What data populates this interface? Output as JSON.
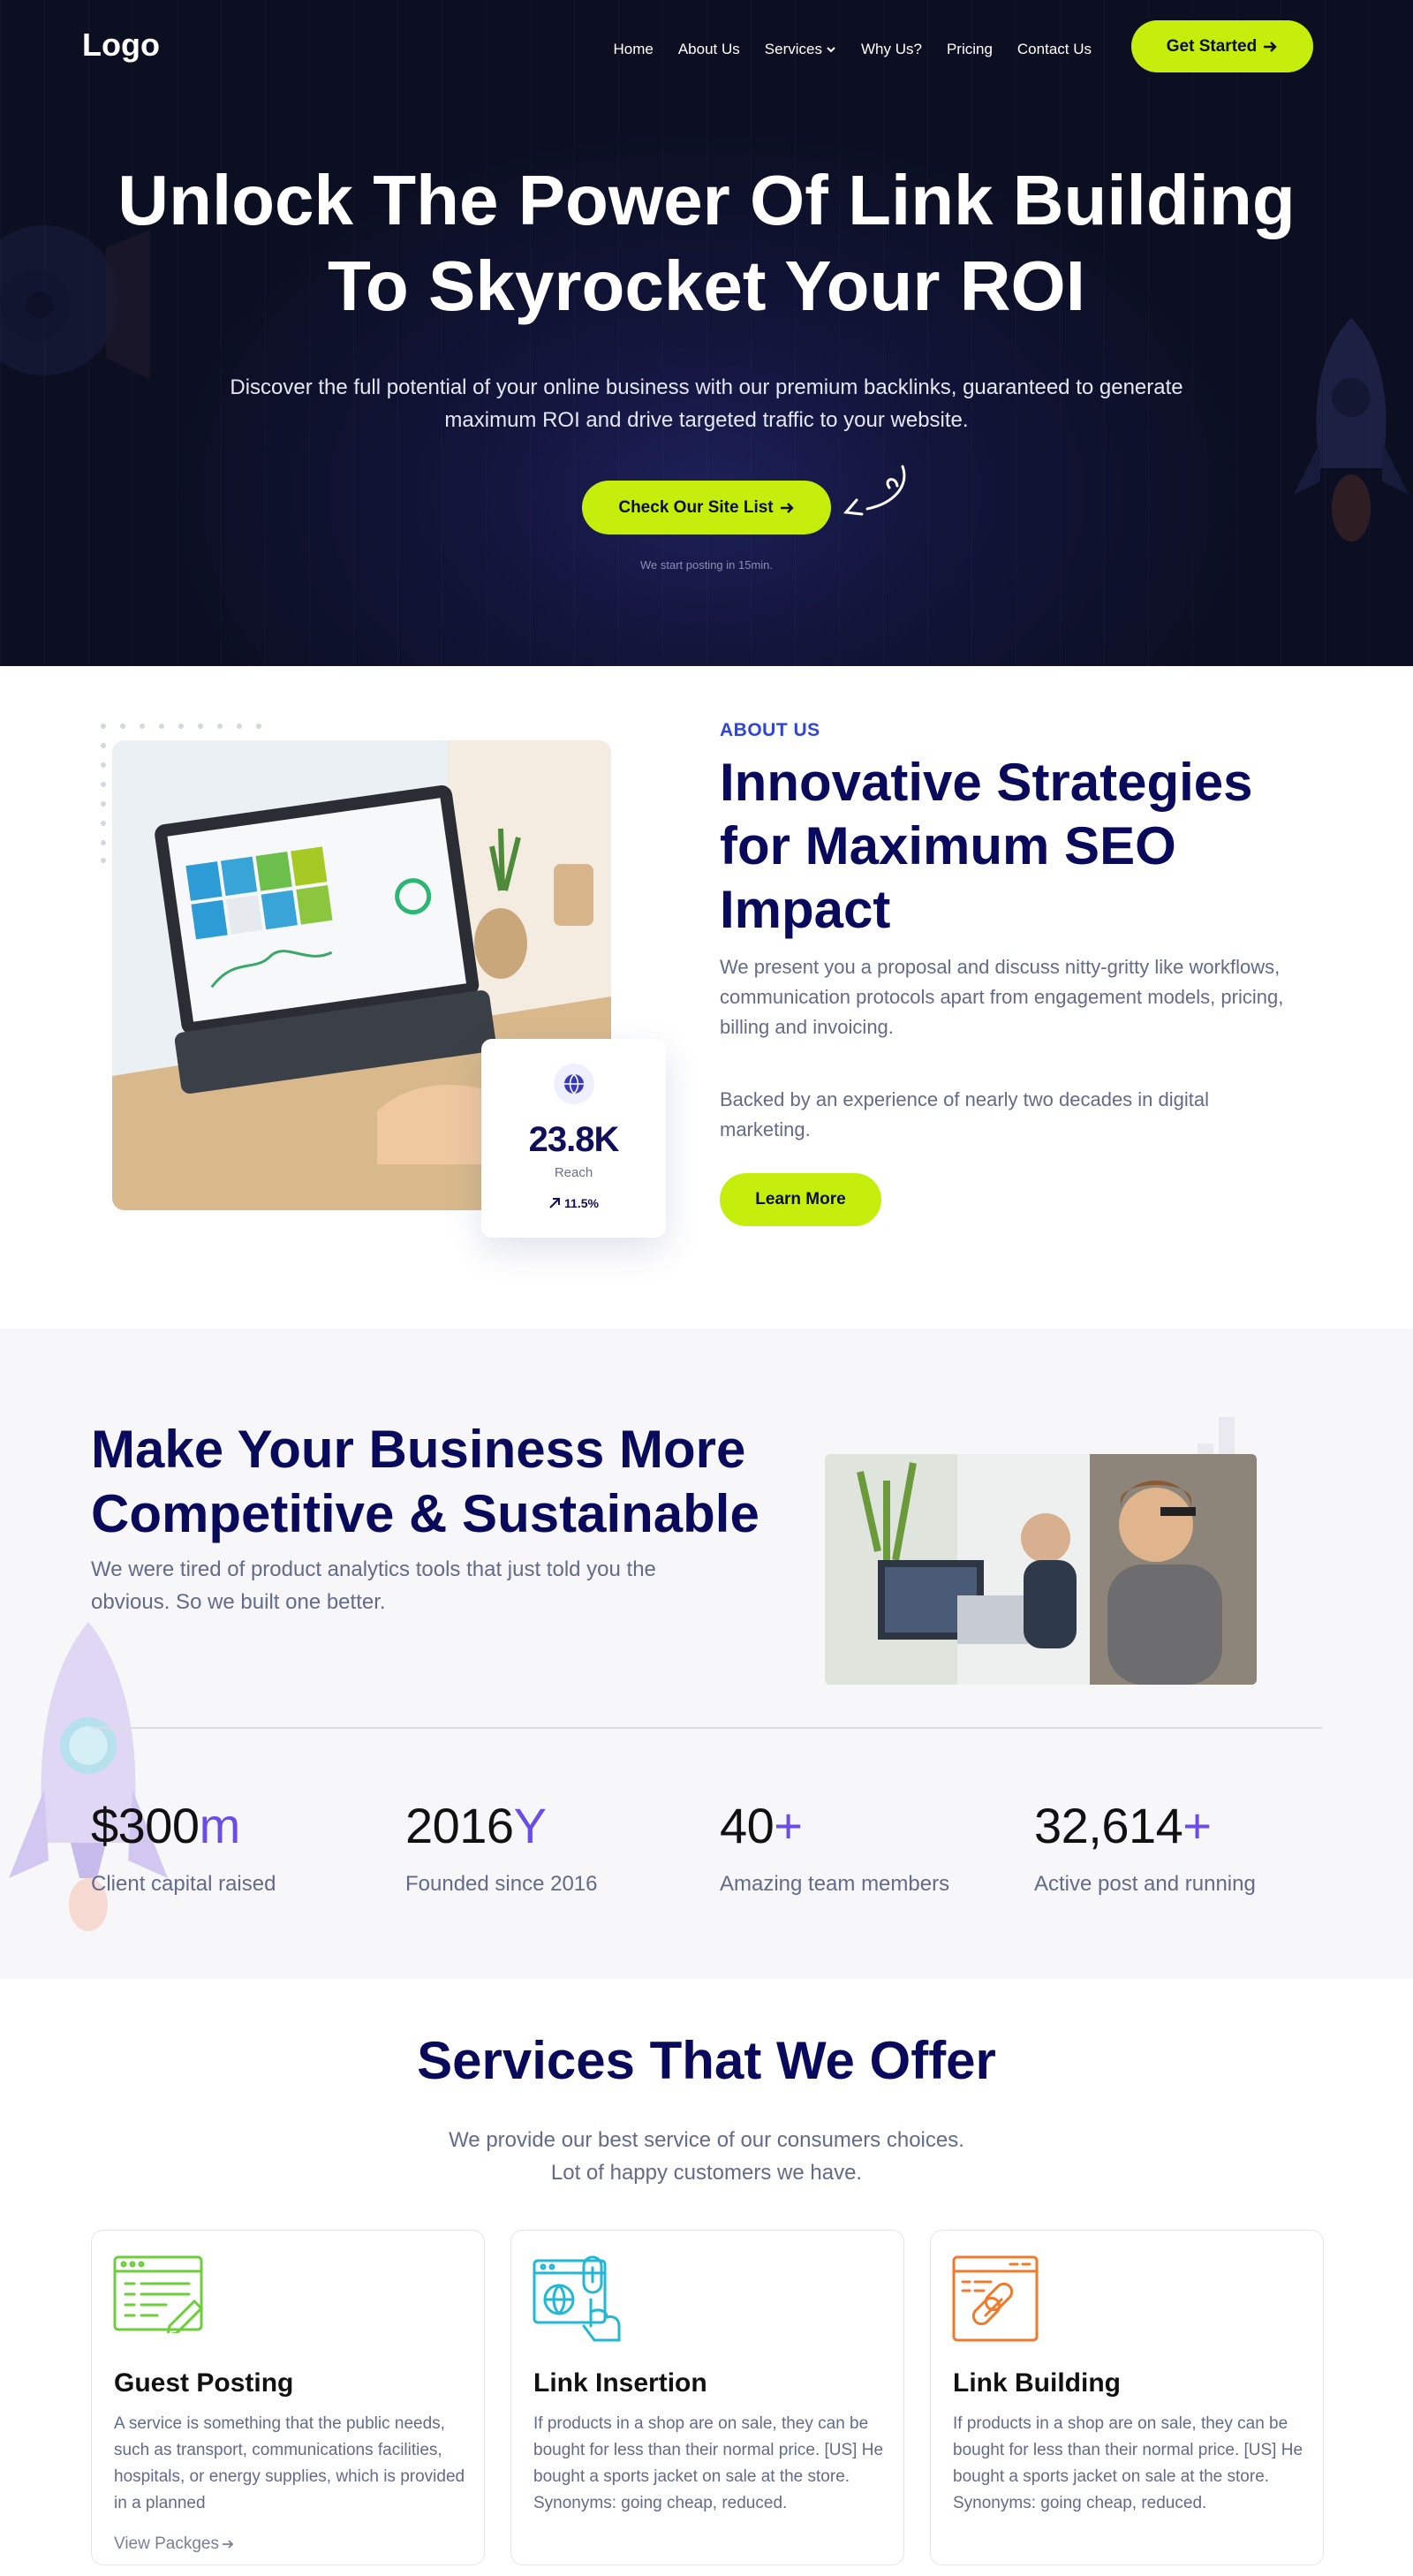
{
  "header": {
    "logo": "Logo",
    "nav": [
      {
        "label": "Home"
      },
      {
        "label": "About Us"
      },
      {
        "label": "Services"
      },
      {
        "label": "Why Us?"
      },
      {
        "label": "Pricing"
      },
      {
        "label": "Contact Us"
      }
    ],
    "cta": "Get Started"
  },
  "hero": {
    "title_line1": "Unlock The Power Of Link Building",
    "title_line2": "To Skyrocket Your ROI",
    "subtitle": "Discover the full potential of your online business with our premium backlinks, guaranteed to generate maximum ROI and drive targeted traffic to your website.",
    "cta": "Check Our Site List",
    "note": "We start posting in 15min."
  },
  "about": {
    "stat_value": "23.8K",
    "stat_label": "Reach",
    "stat_change": "11.5%",
    "eyebrow": "ABOUT US",
    "title": "Innovative Strategies for Maximum SEO Impact",
    "paragraph1": "We present you a proposal and discuss nitty-gritty like workflows, communication protocols apart from engagement models, pricing, billing and invoicing.",
    "paragraph2": "Backed by an experience of nearly two decades in digital marketing.",
    "cta": "Learn More"
  },
  "competitive": {
    "title": "Make Your Business More Competitive & Sustainable",
    "paragraph": "We were tired of product analytics tools that just told you the obvious. So we built one better.",
    "stats": [
      {
        "value": "$300",
        "suffix": "m",
        "caption": "Client capital raised"
      },
      {
        "value": "2016",
        "suffix": "Y",
        "caption": "Founded since 2016"
      },
      {
        "value": "40",
        "suffix": "+",
        "caption": "Amazing team members"
      },
      {
        "value": "32,614",
        "suffix": "+",
        "caption": "Active post and running"
      }
    ]
  },
  "services": {
    "title": "Services That We Offer",
    "subtitle_line1": "We provide our best service of our consumers choices.",
    "subtitle_line2": "Lot of happy customers we have.",
    "cards": [
      {
        "title": "Guest Posting",
        "text": "A service is something that the public needs, such as transport, communications facilities, hospitals, or energy supplies, which is provided in a planned",
        "link": "View Packges",
        "icon": "guest-posting-icon",
        "color": "#6ccf3a"
      },
      {
        "title": "Link Insertion",
        "text": "If products in a shop are on sale, they can be bought for less than their normal price. [US] He bought a sports jacket on sale at the store. Synonyms: going cheap, reduced.",
        "icon": "link-insertion-icon",
        "color": "#22b8d4"
      },
      {
        "title": "Link Building",
        "text": "If products in a shop are on sale, they can be bought for less than their normal price. [US] He bought a sports jacket on sale at the store. Synonyms: going cheap, reduced.",
        "icon": "link-building-icon",
        "color": "#f07a2c"
      }
    ]
  },
  "colors": {
    "accent_lime": "#c5ee0d",
    "navy": "#0a0a5c",
    "purple": "#6a4de8",
    "hero_bg": "#0c0f22"
  }
}
